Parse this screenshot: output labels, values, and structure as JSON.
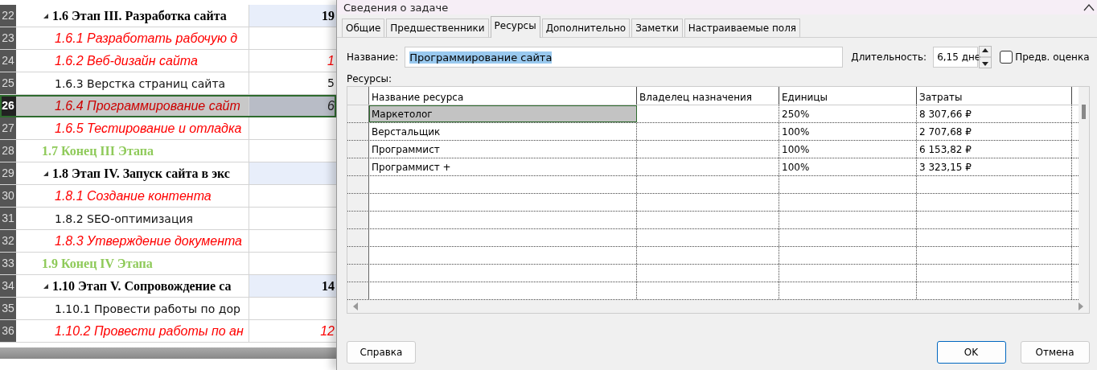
{
  "gantt": {
    "rows": [
      {
        "number": "22",
        "kind": "summary",
        "name": "1.6 Этап III. Разработка сайта",
        "value": "19",
        "expanded": true,
        "selected": false,
        "children": [
          {
            "number": "23",
            "kind": "critical",
            "name": "1.6.1 Разработать рабочую д",
            "selected": false
          },
          {
            "number": "24",
            "kind": "critical",
            "name": "1.6.2 Веб-дизайн сайта",
            "value": "1",
            "selected": false
          },
          {
            "number": "25",
            "kind": "task",
            "name": "1.6.3 Верстка страниц сайта",
            "value": "5",
            "selected": false
          },
          {
            "number": "26",
            "kind": "critical",
            "name": "1.6.4 Программирование сайт",
            "value": "6",
            "selected": true
          },
          {
            "number": "27",
            "kind": "critical",
            "name": "1.6.5 Тестирование и отладка",
            "selected": false
          }
        ]
      },
      {
        "number": "28",
        "kind": "milestone",
        "name": "1.7 Конец III Этапа",
        "selected": false
      },
      {
        "number": "29",
        "kind": "summary",
        "name": "1.8 Этап IV. Запуск сайта в экс",
        "expanded": true,
        "selected": false,
        "children": [
          {
            "number": "30",
            "kind": "critical",
            "name": "1.8.1 Создание контента",
            "selected": false
          },
          {
            "number": "31",
            "kind": "task",
            "name": "1.8.2 SEO-оптимизация",
            "selected": false
          },
          {
            "number": "32",
            "kind": "critical",
            "name": "1.8.3 Утверждение документа",
            "selected": false
          }
        ]
      },
      {
        "number": "33",
        "kind": "milestone",
        "name": "1.9 Конец IV Этапа",
        "selected": false
      },
      {
        "number": "34",
        "kind": "summary",
        "name": "1.10 Этап V. Сопровождение са",
        "value": "14",
        "expanded": true,
        "selected": false,
        "children": [
          {
            "number": "35",
            "kind": "task",
            "name": "1.10.1 Провести работы по дор",
            "selected": false
          },
          {
            "number": "36",
            "kind": "critical",
            "name": "1.10.2 Провести работы по ан",
            "value": "12",
            "selected": false
          }
        ]
      }
    ]
  },
  "dialog": {
    "title": "Сведения о задаче",
    "tabs": [
      {
        "label": "Общие",
        "selected": false
      },
      {
        "label": "Предшественники",
        "selected": false
      },
      {
        "label": "Ресурсы",
        "selected": true
      },
      {
        "label": "Дополнительно",
        "selected": false
      },
      {
        "label": "Заметки",
        "selected": false
      },
      {
        "label": "Настраиваемые поля",
        "selected": false
      }
    ],
    "name_label": "Название:",
    "name_value": "Программирование сайта",
    "duration_label": "Длительность:",
    "duration_value": "6,15 дне",
    "estimate": {
      "label": "Предв. оценка",
      "checked": false
    },
    "resources_label": "Ресурсы:",
    "columns": [
      "Название ресурса",
      "Владелец назначения",
      "Единицы",
      "Затраты"
    ],
    "rows": [
      {
        "name": "Маркетолог",
        "units": "250%",
        "cost": "8 307,66 ₽",
        "selected": true
      },
      {
        "name": "Верстальщик",
        "units": "100%",
        "cost": "2 707,68 ₽",
        "selected": false
      },
      {
        "name": "Программист",
        "units": "100%",
        "cost": "6 153,82 ₽",
        "selected": false
      },
      {
        "name": "Программист +",
        "units": "100%",
        "cost": "3 323,15 ₽",
        "selected": false
      }
    ],
    "buttons": {
      "help": "Справка",
      "ok": "OK",
      "cancel": "Отмена"
    }
  }
}
